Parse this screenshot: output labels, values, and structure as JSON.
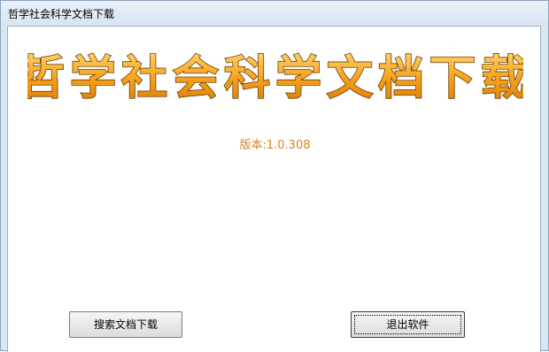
{
  "window": {
    "title": "哲学社会科学文档下载"
  },
  "banner": {
    "text": "哲学社会科学文档下载",
    "fill_color": "#f6a21a",
    "outline_color": "#7a4a10"
  },
  "version": {
    "text": "版本:1.0.308",
    "color": "#d7821f"
  },
  "buttons": {
    "search_label": "搜索文档下载",
    "exit_label": "退出软件"
  }
}
